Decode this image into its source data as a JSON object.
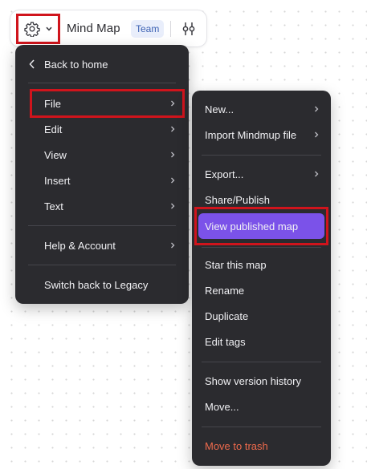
{
  "toolbar": {
    "title": "Mind Map",
    "badge": "Team"
  },
  "main_menu": {
    "back": "Back to home",
    "items": [
      {
        "label": "File"
      },
      {
        "label": "Edit"
      },
      {
        "label": "View"
      },
      {
        "label": "Insert"
      },
      {
        "label": "Text"
      }
    ],
    "help": "Help & Account",
    "legacy": "Switch back to Legacy"
  },
  "file_submenu": {
    "new": "New...",
    "import": "Import Mindmup file",
    "export": "Export...",
    "share": "Share/Publish",
    "view_published": "View published map",
    "star": "Star this map",
    "rename": "Rename",
    "duplicate": "Duplicate",
    "edit_tags": "Edit tags",
    "version_history": "Show version history",
    "move": "Move...",
    "trash": "Move to trash"
  },
  "colors": {
    "menu_bg": "#2b2b2f",
    "accent": "#7b52e9",
    "highlight_box": "#d0141c",
    "danger": "#ee6a4c",
    "badge_bg": "#e9eefb",
    "badge_text": "#3d62b3"
  }
}
